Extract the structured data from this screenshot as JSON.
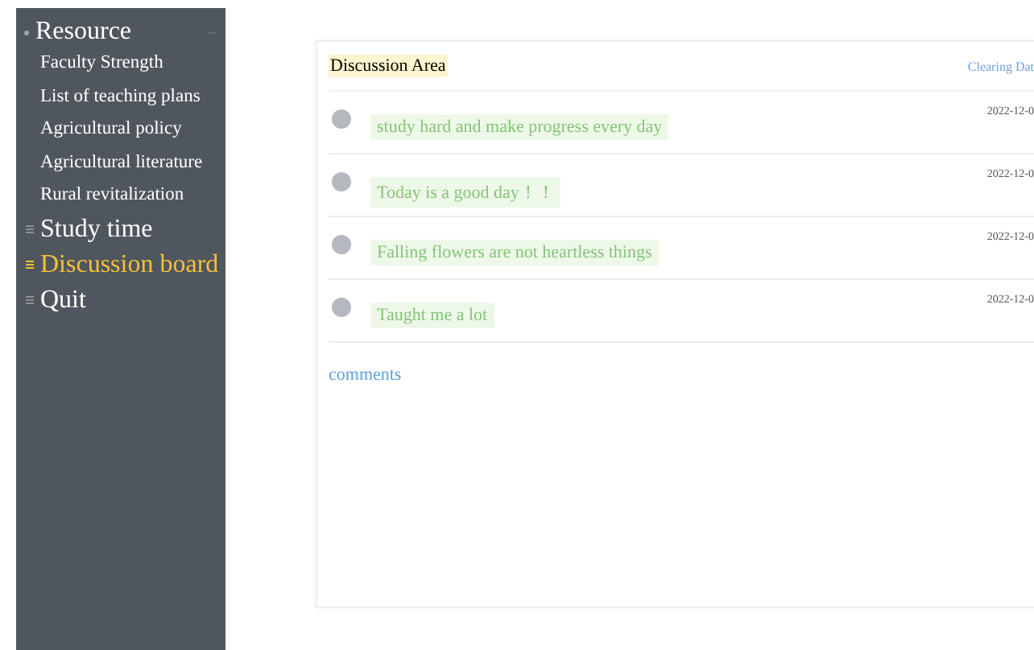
{
  "sidebar": {
    "group": {
      "label": "Resource",
      "children": [
        {
          "label": "Faculty Strength"
        },
        {
          "label": "List of teaching plans"
        },
        {
          "label": "Agricultural policy"
        },
        {
          "label": "Agricultural literature"
        },
        {
          "label": "Rural revitalization"
        }
      ]
    },
    "items": [
      {
        "label": "Study time",
        "selected": false
      },
      {
        "label": "Discussion board",
        "selected": true
      },
      {
        "label": "Quit",
        "selected": false
      }
    ]
  },
  "panel": {
    "title": "Discussion Area",
    "action": "Clearing Dat",
    "posts": [
      {
        "text": "study hard and make progress every day",
        "date": "2022-12-0"
      },
      {
        "text": "Today is a good day！！",
        "date": "2022-12-0"
      },
      {
        "text": "Falling flowers are not heartless things",
        "date": "2022-12-0"
      },
      {
        "text": "Taught me a lot",
        "date": "2022-12-0"
      }
    ],
    "link": "comments"
  }
}
